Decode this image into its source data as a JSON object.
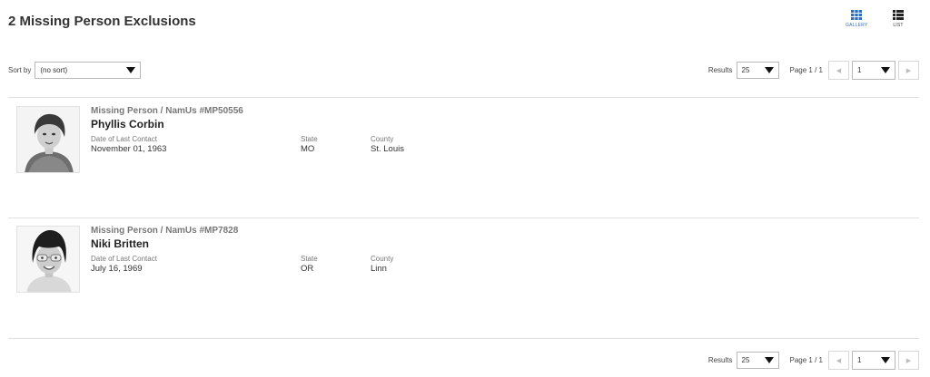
{
  "header": {
    "title": "2 Missing Person Exclusions"
  },
  "views": {
    "gallery_label": "GALLERY",
    "list_label": "LIST",
    "active": "gallery"
  },
  "sort": {
    "label": "Sort by",
    "value": "(no sort)"
  },
  "pager": {
    "results_label": "Results",
    "results_value": "25",
    "page_label": "Page 1 / 1",
    "page_value": "1",
    "prev_icon": "◀",
    "next_icon": "▶"
  },
  "records": [
    {
      "category": "Missing Person / NamUs #MP50556",
      "name": "Phyllis Corbin",
      "date_label": "Date of Last Contact",
      "date": "November 01, 1963",
      "state_label": "State",
      "state": "MO",
      "county_label": "County",
      "county": "St. Louis"
    },
    {
      "category": "Missing Person / NamUs #MP7828",
      "name": "Niki Britten",
      "date_label": "Date of Last Contact",
      "date": "July 16, 1969",
      "state_label": "State",
      "state": "OR",
      "county_label": "County",
      "county": "Linn"
    }
  ],
  "colors": {
    "accent": "#2f6fba",
    "divider": "#e0e0e0",
    "text": "#333333"
  }
}
